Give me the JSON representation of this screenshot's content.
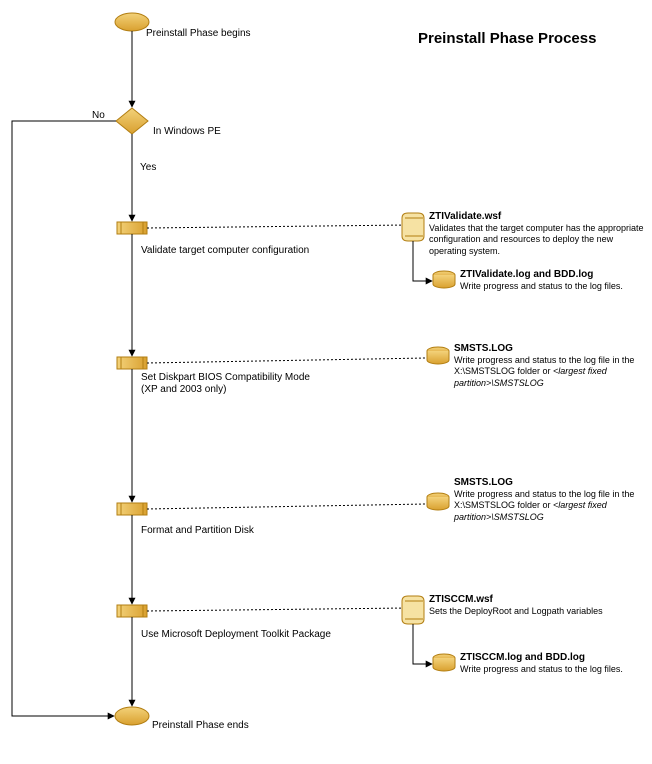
{
  "title": "Preinstall Phase Process",
  "start": {
    "label": "Preinstall Phase begins"
  },
  "end": {
    "label": "Preinstall Phase ends"
  },
  "decision": {
    "label": "In Windows PE",
    "no": "No",
    "yes": "Yes"
  },
  "steps": {
    "s1": {
      "label": "Validate target computer configuration"
    },
    "s2": {
      "label": "Set Diskpart BIOS Compatibility Mode",
      "sub": "(XP and 2003 only)"
    },
    "s3": {
      "label": "Format and Partition Disk"
    },
    "s4": {
      "label": "Use Microsoft Deployment Toolkit Package"
    }
  },
  "annot": {
    "a1": {
      "head": "ZTIValidate.wsf",
      "body_a": "Validates that the target computer has the appropriate configuration and resources to deploy the new operating system."
    },
    "a1b": {
      "head": "ZTIValidate.log and BDD.log",
      "body_a": "Write progress and status to the log files."
    },
    "a2": {
      "head": "SMSTS.LOG",
      "body_a": "Write progress and status to the log file in the X:\\SMSTSLOG folder or ",
      "body_i": "<largest fixed partition>\\SMSTSLOG"
    },
    "a3": {
      "head": "SMSTS.LOG",
      "body_a": "Write progress and status to the log file in the X:\\SMSTSLOG folder or ",
      "body_i": "<largest fixed partition>\\SMSTSLOG"
    },
    "a4": {
      "head": "ZTISCCM.wsf",
      "body_a": "Sets the DeployRoot and Logpath variables"
    },
    "a4b": {
      "head": "ZTISCCM.log and BDD.log",
      "body_a": "Write progress and status to the log files."
    }
  },
  "chart_data": {
    "type": "flowchart",
    "title": "Preinstall Phase Process",
    "nodes": [
      {
        "id": "start",
        "type": "terminator",
        "label": "Preinstall Phase begins"
      },
      {
        "id": "decision",
        "type": "decision",
        "label": "In Windows PE"
      },
      {
        "id": "s1",
        "type": "process",
        "label": "Validate target computer configuration"
      },
      {
        "id": "s2",
        "type": "process",
        "label": "Set Diskpart BIOS Compatibility Mode (XP and 2003 only)"
      },
      {
        "id": "s3",
        "type": "process",
        "label": "Format and Partition Disk"
      },
      {
        "id": "s4",
        "type": "process",
        "label": "Use Microsoft Deployment Toolkit Package"
      },
      {
        "id": "end",
        "type": "terminator",
        "label": "Preinstall Phase ends"
      }
    ],
    "edges": [
      {
        "from": "start",
        "to": "decision"
      },
      {
        "from": "decision",
        "to": "s1",
        "label": "Yes"
      },
      {
        "from": "decision",
        "to": "end",
        "label": "No"
      },
      {
        "from": "s1",
        "to": "s2"
      },
      {
        "from": "s2",
        "to": "s3"
      },
      {
        "from": "s3",
        "to": "s4"
      },
      {
        "from": "s4",
        "to": "end"
      }
    ],
    "annotations": [
      {
        "attached_to": "s1",
        "kind": "script",
        "title": "ZTIValidate.wsf",
        "text": "Validates that the target computer has the appropriate configuration and resources to deploy the new operating system."
      },
      {
        "attached_to": "s1",
        "kind": "log",
        "title": "ZTIValidate.log and BDD.log",
        "text": "Write progress and status to the log files."
      },
      {
        "attached_to": "s2",
        "kind": "log",
        "title": "SMSTS.LOG",
        "text": "Write progress and status to the log file in the X:\\SMSTSLOG folder or <largest fixed partition>\\SMSTSLOG"
      },
      {
        "attached_to": "s3",
        "kind": "log",
        "title": "SMSTS.LOG",
        "text": "Write progress and status to the log file in the X:\\SMSTSLOG folder or <largest fixed partition>\\SMSTSLOG"
      },
      {
        "attached_to": "s4",
        "kind": "script",
        "title": "ZTISCCM.wsf",
        "text": "Sets the DeployRoot and Logpath variables"
      },
      {
        "attached_to": "s4",
        "kind": "log",
        "title": "ZTISCCM.log and BDD.log",
        "text": "Write progress and status to the log files."
      }
    ]
  }
}
